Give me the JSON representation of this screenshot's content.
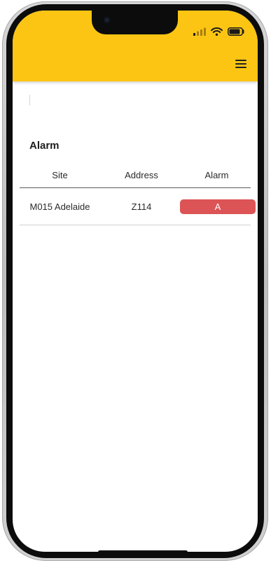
{
  "header": {
    "background": "#fcc514",
    "menu_icon": "hamburger-menu-icon"
  },
  "status_bar": {
    "signal_icon": "cellular-signal-icon",
    "wifi_icon": "wifi-icon",
    "battery_icon": "battery-icon"
  },
  "section": {
    "title": "Alarm"
  },
  "table": {
    "columns": [
      "Site",
      "Address",
      "Alarm"
    ],
    "rows": [
      {
        "site": "M015 Adelaide",
        "address": "Z114",
        "alarm": "A",
        "alarm_color": "#dc5455"
      }
    ]
  }
}
